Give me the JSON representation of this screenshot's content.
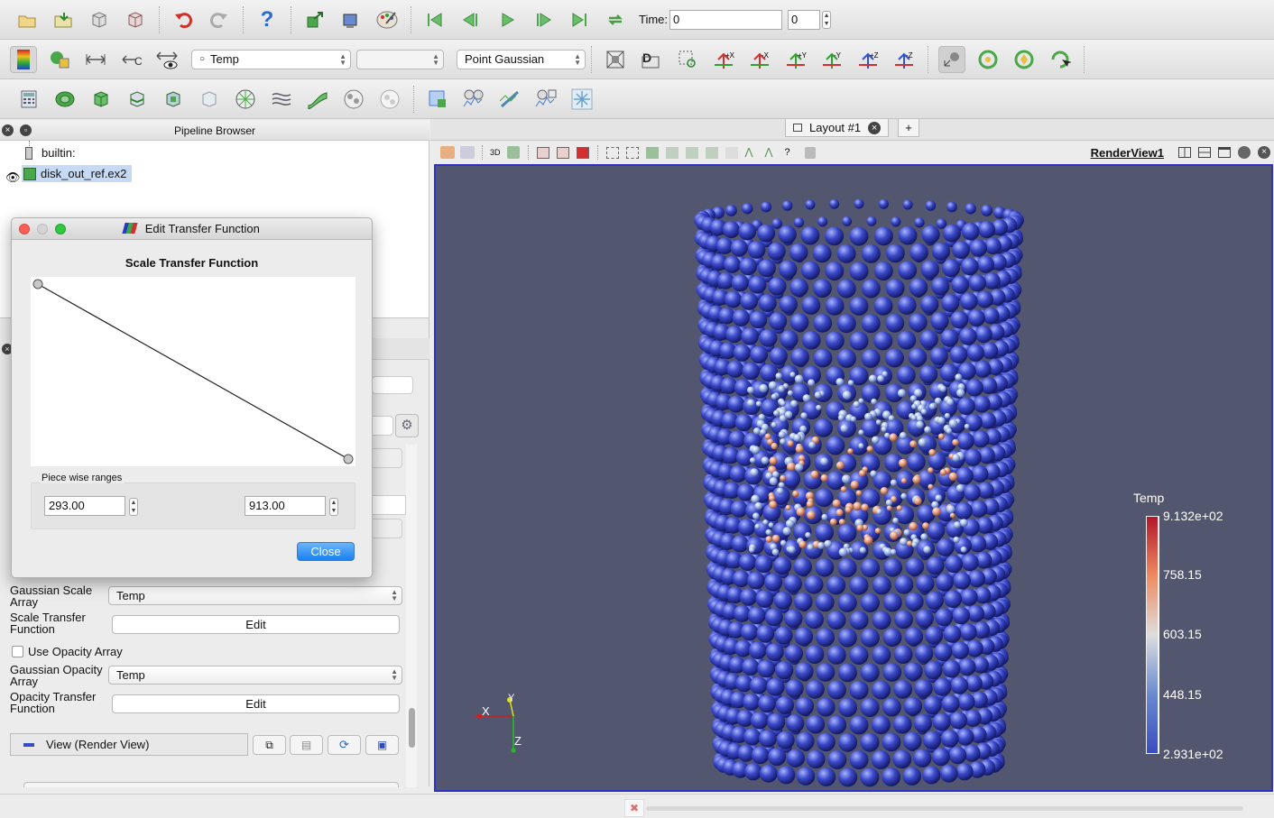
{
  "toolbar": {
    "time_label": "Time:",
    "time_value": "0",
    "time_step": "0",
    "color_array": "Temp",
    "component": "",
    "representation": "Point Gaussian",
    "view_3d_label": "3D"
  },
  "pipeline": {
    "title": "Pipeline Browser",
    "root": "builtin:",
    "item": "disk_out_ref.ex2"
  },
  "properties": {
    "gaussian_scale_array_label": "Gaussian Scale Array",
    "gaussian_scale_array_value": "Temp",
    "scale_tf_label": "Scale Transfer Function",
    "scale_tf_button": "Edit",
    "use_opacity_label": "Use Opacity Array",
    "gaussian_opacity_label": "Gaussian Opacity Array",
    "gaussian_opacity_value": "Temp",
    "opacity_tf_label": "Opacity Transfer Function",
    "opacity_tf_button": "Edit",
    "view_section": "View (Render View)"
  },
  "dialog": {
    "title": "Edit Transfer Function",
    "heading": "Scale Transfer Function",
    "ranges_label": "Piece wise ranges",
    "range_min": "293.00",
    "range_max": "913.00",
    "close_label": "Close",
    "points": [
      [
        293,
        1
      ],
      [
        913,
        0
      ]
    ]
  },
  "layout": {
    "tab_label": "Layout #1",
    "add_tab": "+",
    "view_name": "RenderView1"
  },
  "colorbar": {
    "title": "Temp",
    "labels": [
      "9.132e+02",
      "758.15",
      "603.15",
      "448.15",
      "2.931e+02"
    ],
    "colors": [
      "#b2182b",
      "#ef8a62",
      "#dddddd",
      "#6a8ad0",
      "#3b4cc0"
    ]
  },
  "axes": {
    "x": "X",
    "y": "Y",
    "z": "Z"
  }
}
